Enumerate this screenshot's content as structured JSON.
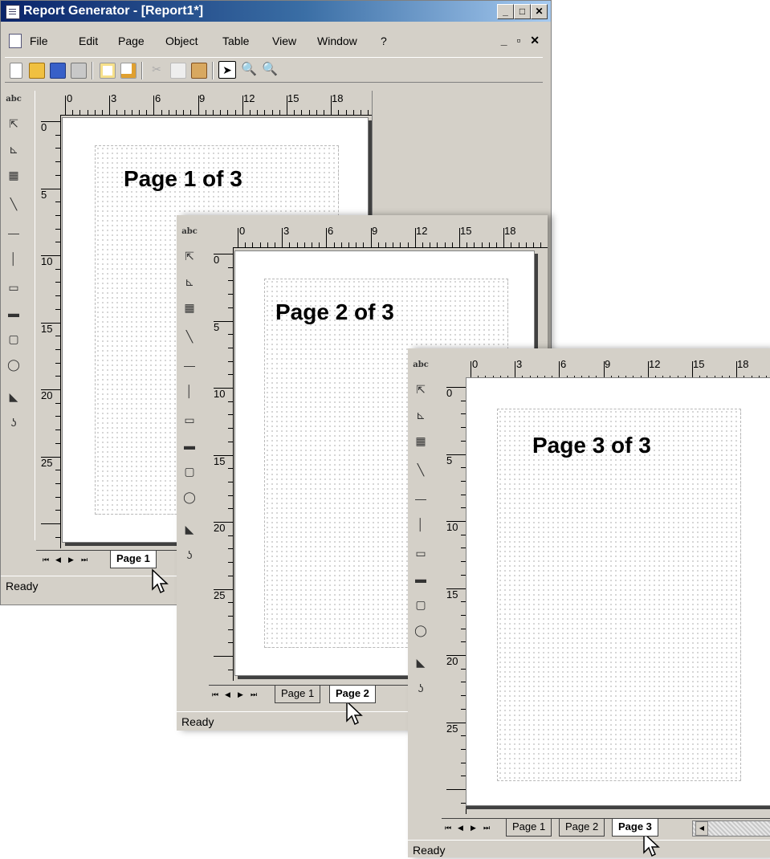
{
  "window": {
    "title": "Report Generator - [Report1*]",
    "controls": {
      "minimize": "_",
      "maximize": "□",
      "close": "✕"
    },
    "mdi_controls": "_ ▫ ✕"
  },
  "menu": [
    "File",
    "Edit",
    "Page",
    "Object",
    "Table",
    "View",
    "Window",
    "?"
  ],
  "toolbar_icons": [
    "new-icon",
    "open-icon",
    "save-icon",
    "print-icon",
    "new-page-icon",
    "copy-page-icon",
    "cut-icon",
    "copy-icon",
    "paste-icon",
    "pointer-icon",
    "zoom-in-icon",
    "zoom-out-icon"
  ],
  "tools": [
    {
      "name": "text-tool",
      "glyph": "abc"
    },
    {
      "name": "chart-xy-tool",
      "glyph": "⇱"
    },
    {
      "name": "axis-tool",
      "glyph": "⊾"
    },
    {
      "name": "table-tool",
      "glyph": "▦"
    },
    {
      "name": "diagonal-line-tool",
      "glyph": "╲"
    },
    {
      "name": "horizontal-line-tool",
      "glyph": "—"
    },
    {
      "name": "vertical-line-tool",
      "glyph": "│"
    },
    {
      "name": "rectangle-tool",
      "glyph": "▭"
    },
    {
      "name": "filled-rectangle-tool",
      "glyph": "▬"
    },
    {
      "name": "rounded-rectangle-tool",
      "glyph": "▢"
    },
    {
      "name": "ellipse-tool",
      "glyph": "◯"
    },
    {
      "name": "polygon-tool",
      "glyph": "◣"
    },
    {
      "name": "freeform-tool",
      "glyph": "ʖ"
    }
  ],
  "ruler": {
    "h_labels": [
      "0",
      "3",
      "6",
      "9",
      "12",
      "15",
      "18"
    ],
    "v_labels": [
      "0",
      "5",
      "10",
      "15",
      "20",
      "25"
    ]
  },
  "pages": [
    {
      "label": "Page 1 of 3",
      "tabs": [
        "Page 1"
      ],
      "active_tab": "Page 1",
      "status": "Ready"
    },
    {
      "label": "Page 2 of 3",
      "tabs": [
        "Page 1",
        "Page 2"
      ],
      "active_tab": "Page 2",
      "status": "Ready"
    },
    {
      "label": "Page 3 of 3",
      "tabs": [
        "Page 1",
        "Page 2",
        "Page 3"
      ],
      "active_tab": "Page 3",
      "status": "Ready"
    }
  ],
  "nav": {
    "first": "⏮",
    "prev": "◀",
    "next": "▶",
    "last": "⏭"
  }
}
